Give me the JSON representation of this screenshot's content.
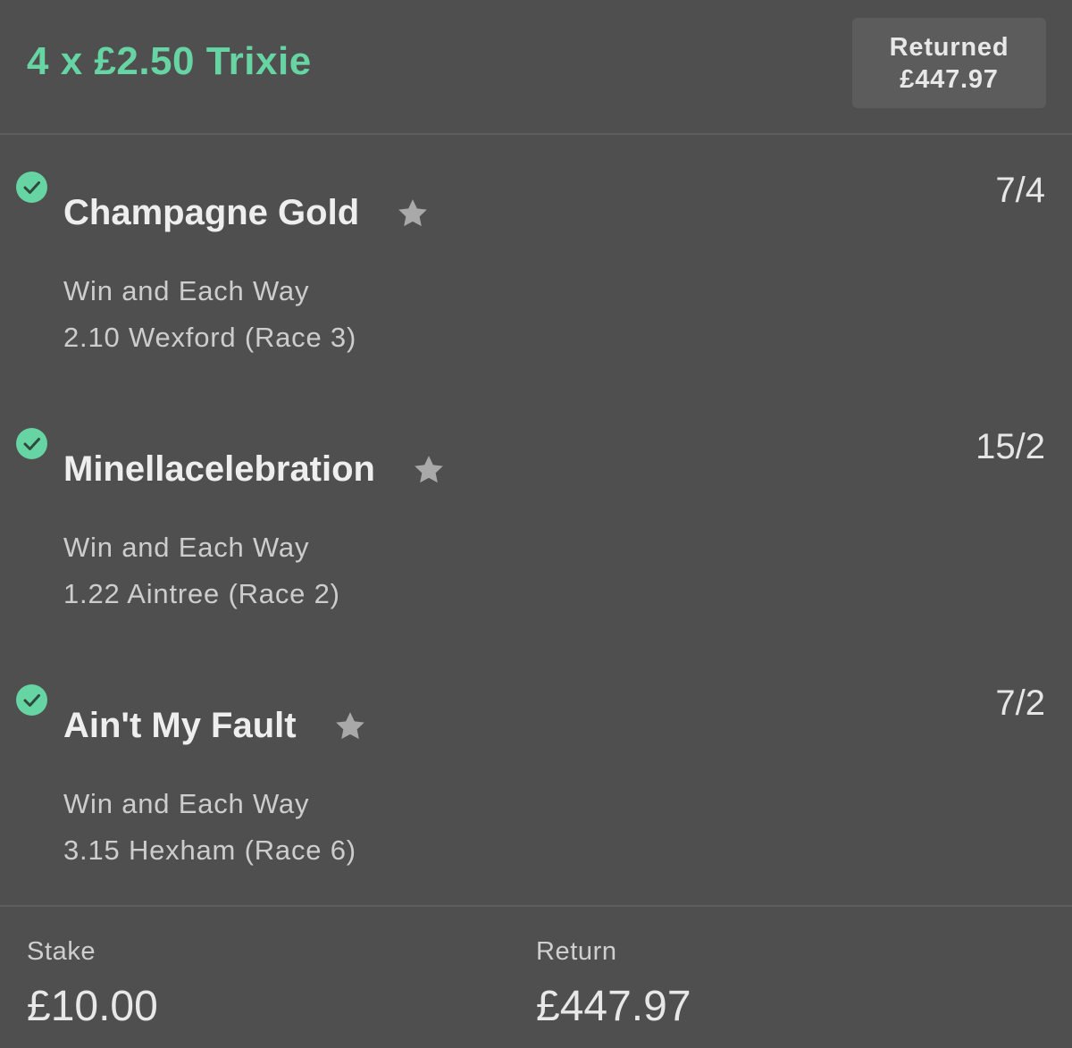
{
  "header": {
    "bet_title": "4 x £2.50 Trixie",
    "returned_label": "Returned",
    "returned_value": "£447.97"
  },
  "selections": [
    {
      "name": "Champagne Gold",
      "odds": "7/4",
      "market": "Win and Each Way",
      "event": "2.10 Wexford (Race 3)",
      "status": "won"
    },
    {
      "name": "Minellacelebration",
      "odds": "15/2",
      "market": "Win and Each Way",
      "event": "1.22 Aintree (Race 2)",
      "status": "won"
    },
    {
      "name": "Ain't My Fault",
      "odds": "7/2",
      "market": "Win and Each Way",
      "event": "3.15 Hexham (Race 6)",
      "status": "won"
    }
  ],
  "footer": {
    "stake_label": "Stake",
    "stake_value": "£10.00",
    "return_label": "Return",
    "return_value": "£447.97"
  },
  "colors": {
    "accent": "#66d4a3",
    "background": "#4f4f4f",
    "panel": "#5c5c5c",
    "star": "#a9a9a9"
  },
  "icons": {
    "status": "check-circle-icon",
    "favourite": "star-icon"
  }
}
